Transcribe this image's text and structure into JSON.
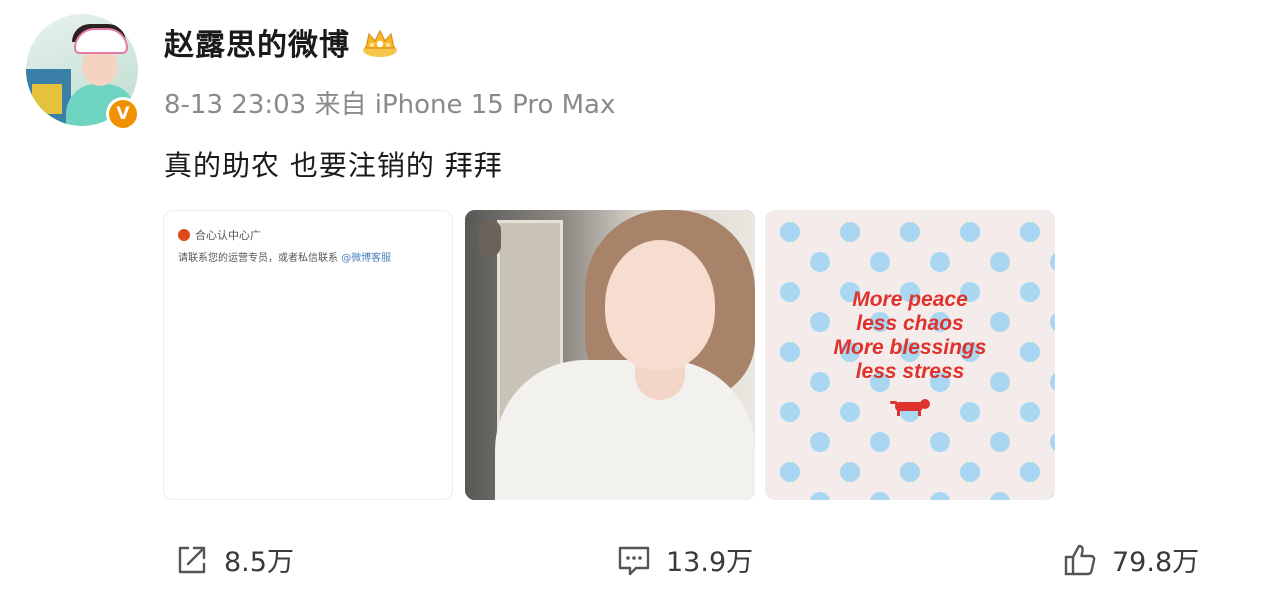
{
  "post": {
    "username": "赵露思的微博",
    "meta": "8-13 23:03 来自 iPhone 15 Pro Max",
    "text": "真的助农 也要注销的 拜拜",
    "verified_badge": "V"
  },
  "images": {
    "screenshot": {
      "header": "合心认中心广",
      "line": "请联系您的运营专员，或者私信联系 ",
      "link": "@微博客服"
    },
    "quote": {
      "lines": [
        "More peace",
        "less chaos",
        "More blessings",
        "less stress"
      ],
      "text_color": "#e0322d",
      "dot_color": "#a9d6f0"
    }
  },
  "actions": {
    "share": {
      "count": "8.5万",
      "icon": "share-icon"
    },
    "comment": {
      "count": "13.9万",
      "icon": "comment-icon"
    },
    "like": {
      "count": "79.8万",
      "icon": "thumbs-up-icon"
    }
  }
}
